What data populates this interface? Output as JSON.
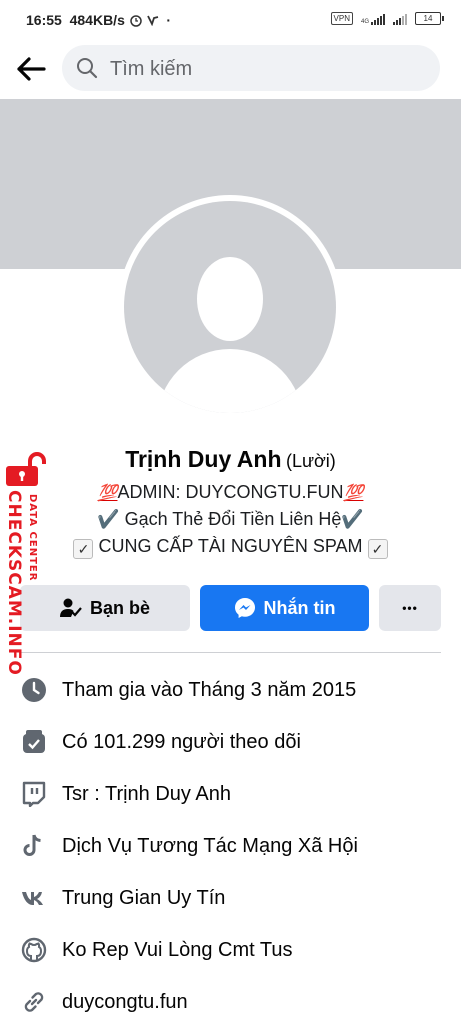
{
  "status_bar": {
    "time": "16:55",
    "speed": "484KB/s",
    "vpn": "VPN",
    "network": "4G",
    "battery": "14",
    "battery_level": 0.14
  },
  "header": {
    "search_placeholder": "Tìm kiếm"
  },
  "profile": {
    "name": "Trịnh Duy Anh",
    "alt_name": "(Lười)",
    "bio": [
      {
        "prefix": "💯",
        "text": "ADMIN: DUYCONGTU.FUN",
        "suffix": "💯"
      },
      {
        "prefix": "✔️",
        "text": " Gạch Thẻ Đổi Tiền Liên Hệ",
        "suffix": "✔️"
      },
      {
        "prefix": "✓",
        "text": " CUNG CẤP TÀI NGUYÊN SPAM ",
        "suffix": "✓"
      }
    ]
  },
  "actions": {
    "friends": "Bạn bè",
    "message": "Nhắn tin",
    "more": "•••"
  },
  "info": [
    {
      "icon": "clock-icon",
      "text": "Tham gia vào Tháng 3 năm 2015"
    },
    {
      "icon": "follower-icon",
      "text": "Có 101.299 người theo dõi"
    },
    {
      "icon": "twitch-icon",
      "text": "Tsr : Trịnh Duy Anh"
    },
    {
      "icon": "tiktok-icon",
      "text": "Dịch Vụ Tương Tác Mạng Xã Hội"
    },
    {
      "icon": "vk-icon",
      "text": "Trung Gian Uy Tín"
    },
    {
      "icon": "github-icon",
      "text": "Ko Rep Vui Lòng Cmt Tus"
    },
    {
      "icon": "link-icon",
      "text": "duycongtu.fun"
    }
  ],
  "watermark": {
    "main": "CHECKSCAM.INFO",
    "sub": "DATA CENTER"
  },
  "colors": {
    "accent": "#1877f2",
    "cover": "#ced0d4",
    "watermark": "#e41b23"
  }
}
